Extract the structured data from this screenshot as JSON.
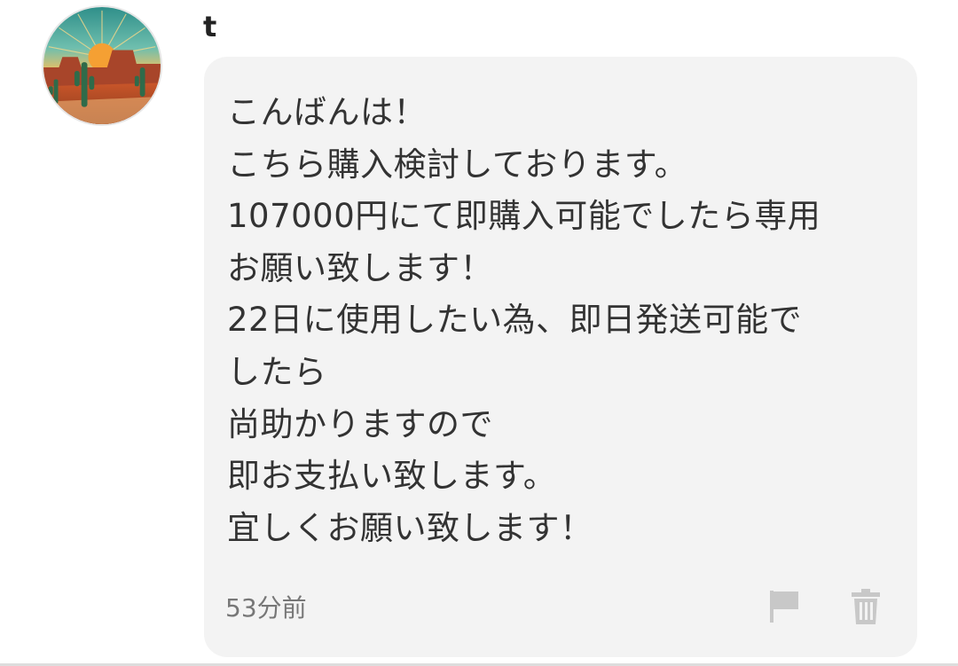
{
  "comment": {
    "username": "t",
    "avatar_icon": "desert-sunset-avatar-icon",
    "message_lines": [
      "こんばんは！",
      "こちら購入検討しております。",
      "107000円にて即購入可能でしたら専用",
      "お願い致します！",
      "22日に使用したい為、即日発送可能で",
      "したら",
      "尚助かりますので",
      "即お支払い致します。",
      "宜しくお願い致します！"
    ],
    "timestamp": "53分前",
    "actions": {
      "report_icon": "flag-icon",
      "delete_icon": "trash-icon"
    },
    "colors": {
      "bubble_background": "#f3f3f3",
      "text": "#333333",
      "meta_text": "#777777",
      "icon": "#c8c8c8"
    }
  }
}
